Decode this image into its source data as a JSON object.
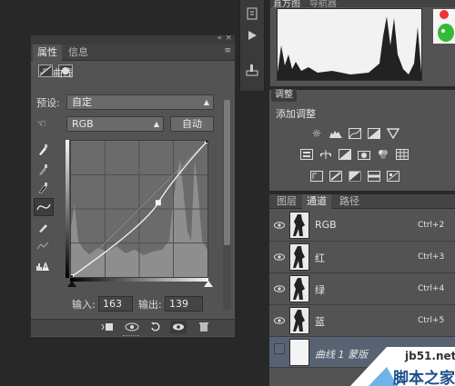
{
  "properties_panel": {
    "tabs": [
      "属性",
      "信息"
    ],
    "collapse_glyph": "«",
    "close_glyph": "×",
    "menu_glyph": "≡",
    "title": "曲线",
    "preset_label": "预设:",
    "preset_value": "自定",
    "channel_value": "RGB",
    "auto_button": "自动",
    "input_label": "输入:",
    "input_value": "163",
    "output_label": "输出:",
    "output_value": "139",
    "curve_points": [
      {
        "input": 0,
        "output": 0
      },
      {
        "input": 163,
        "output": 139
      },
      {
        "input": 255,
        "output": 255
      }
    ],
    "tools": [
      "sample-white-icon",
      "sample-gray-icon",
      "sample-black-icon",
      "curve-edit-icon",
      "pencil-icon",
      "smooth-icon",
      "clipping-warning-icon"
    ],
    "bottom_icons": [
      "clip-to-layer-icon",
      "view-previous-icon",
      "reset-icon",
      "visibility-icon",
      "delete-icon"
    ]
  },
  "histogram_panel": {
    "tabs": [
      "直方图",
      "导航器"
    ]
  },
  "adjustments_panel": {
    "tab": "调整",
    "label": "添加调整"
  },
  "channels_panel": {
    "tabs": [
      "图层",
      "通道",
      "路径"
    ],
    "channels": [
      {
        "name": "RGB",
        "shortcut": "Ctrl+2"
      },
      {
        "name": "红",
        "shortcut": "Ctrl+3"
      },
      {
        "name": "绿",
        "shortcut": "Ctrl+4"
      },
      {
        "name": "蓝",
        "shortcut": "Ctrl+5"
      }
    ],
    "mask_row": {
      "name": "曲线 1 蒙版"
    }
  },
  "watermark": {
    "site": "jb51.net",
    "name": "脚本之家"
  }
}
